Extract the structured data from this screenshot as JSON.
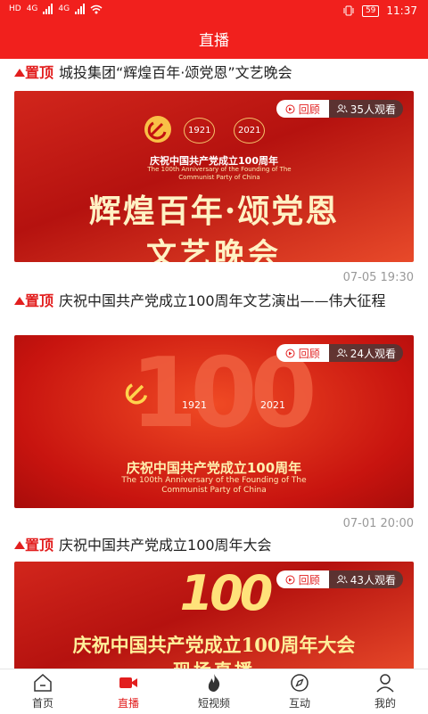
{
  "status": {
    "time": "11:37",
    "battery": "59",
    "net1": "HD",
    "net2": "4G",
    "net3": "4G"
  },
  "header": {
    "title": "直播"
  },
  "pin_label": "置顶",
  "replay_label": "回顾",
  "items": [
    {
      "title": "城投集团“辉煌百年·颂党恩”文艺晚会",
      "views": "35人观看",
      "time": "07-05 19:30",
      "thumb_text1": "庆祝中国共产党成立100周年",
      "thumb_text2": "The 100th Anniversary of the Founding of The Communist Party of China",
      "thumb_big1": "辉煌百年·颂党恩",
      "thumb_big2": "文艺晚会",
      "year1": "1921",
      "year2": "2021"
    },
    {
      "title": "庆祝中国共产党成立100周年文艺演出——伟大征程",
      "views": "24人观看",
      "time": "07-01 20:00",
      "thumb_text1": "庆祝中国共产党成立100周年",
      "thumb_text2": "The 100th Anniversary of the Founding of The Communist Party of China",
      "thumb_big1": "100",
      "year1": "1921",
      "year2": "2021"
    },
    {
      "title": "庆祝中国共产党成立100周年大会",
      "views": "43人观看",
      "thumb_big1": "100",
      "thumb_big2": "庆祝中国共产党成立100周年大会",
      "thumb_big3": "现场直播"
    }
  ],
  "tabs": [
    {
      "label": "首页",
      "icon": "home-icon"
    },
    {
      "label": "直播",
      "icon": "video-camera-icon"
    },
    {
      "label": "短视频",
      "icon": "flame-icon"
    },
    {
      "label": "互动",
      "icon": "compass-icon"
    },
    {
      "label": "我的",
      "icon": "user-icon"
    }
  ],
  "colors": {
    "brand": "#f1201d",
    "pin": "#e21e1e",
    "muted": "#999999"
  }
}
